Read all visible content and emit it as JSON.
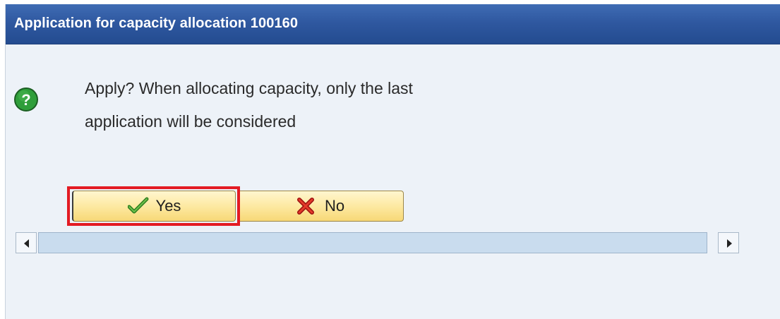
{
  "dialog": {
    "title": "Application for capacity allocation 100160",
    "icon": "question-icon",
    "message_line1": "Apply? When allocating capacity, only the last",
    "message_line2": "application will be considered"
  },
  "buttons": {
    "yes_label": "Yes",
    "yes_icon": "checkmark-icon",
    "no_label": "No",
    "no_icon": "cross-icon"
  },
  "colors": {
    "titlebar": "#2f58a0",
    "background": "#edf2f8",
    "button": "#fde9a2",
    "focus_highlight": "#e31b23",
    "question_icon": "#2f9e3a"
  }
}
